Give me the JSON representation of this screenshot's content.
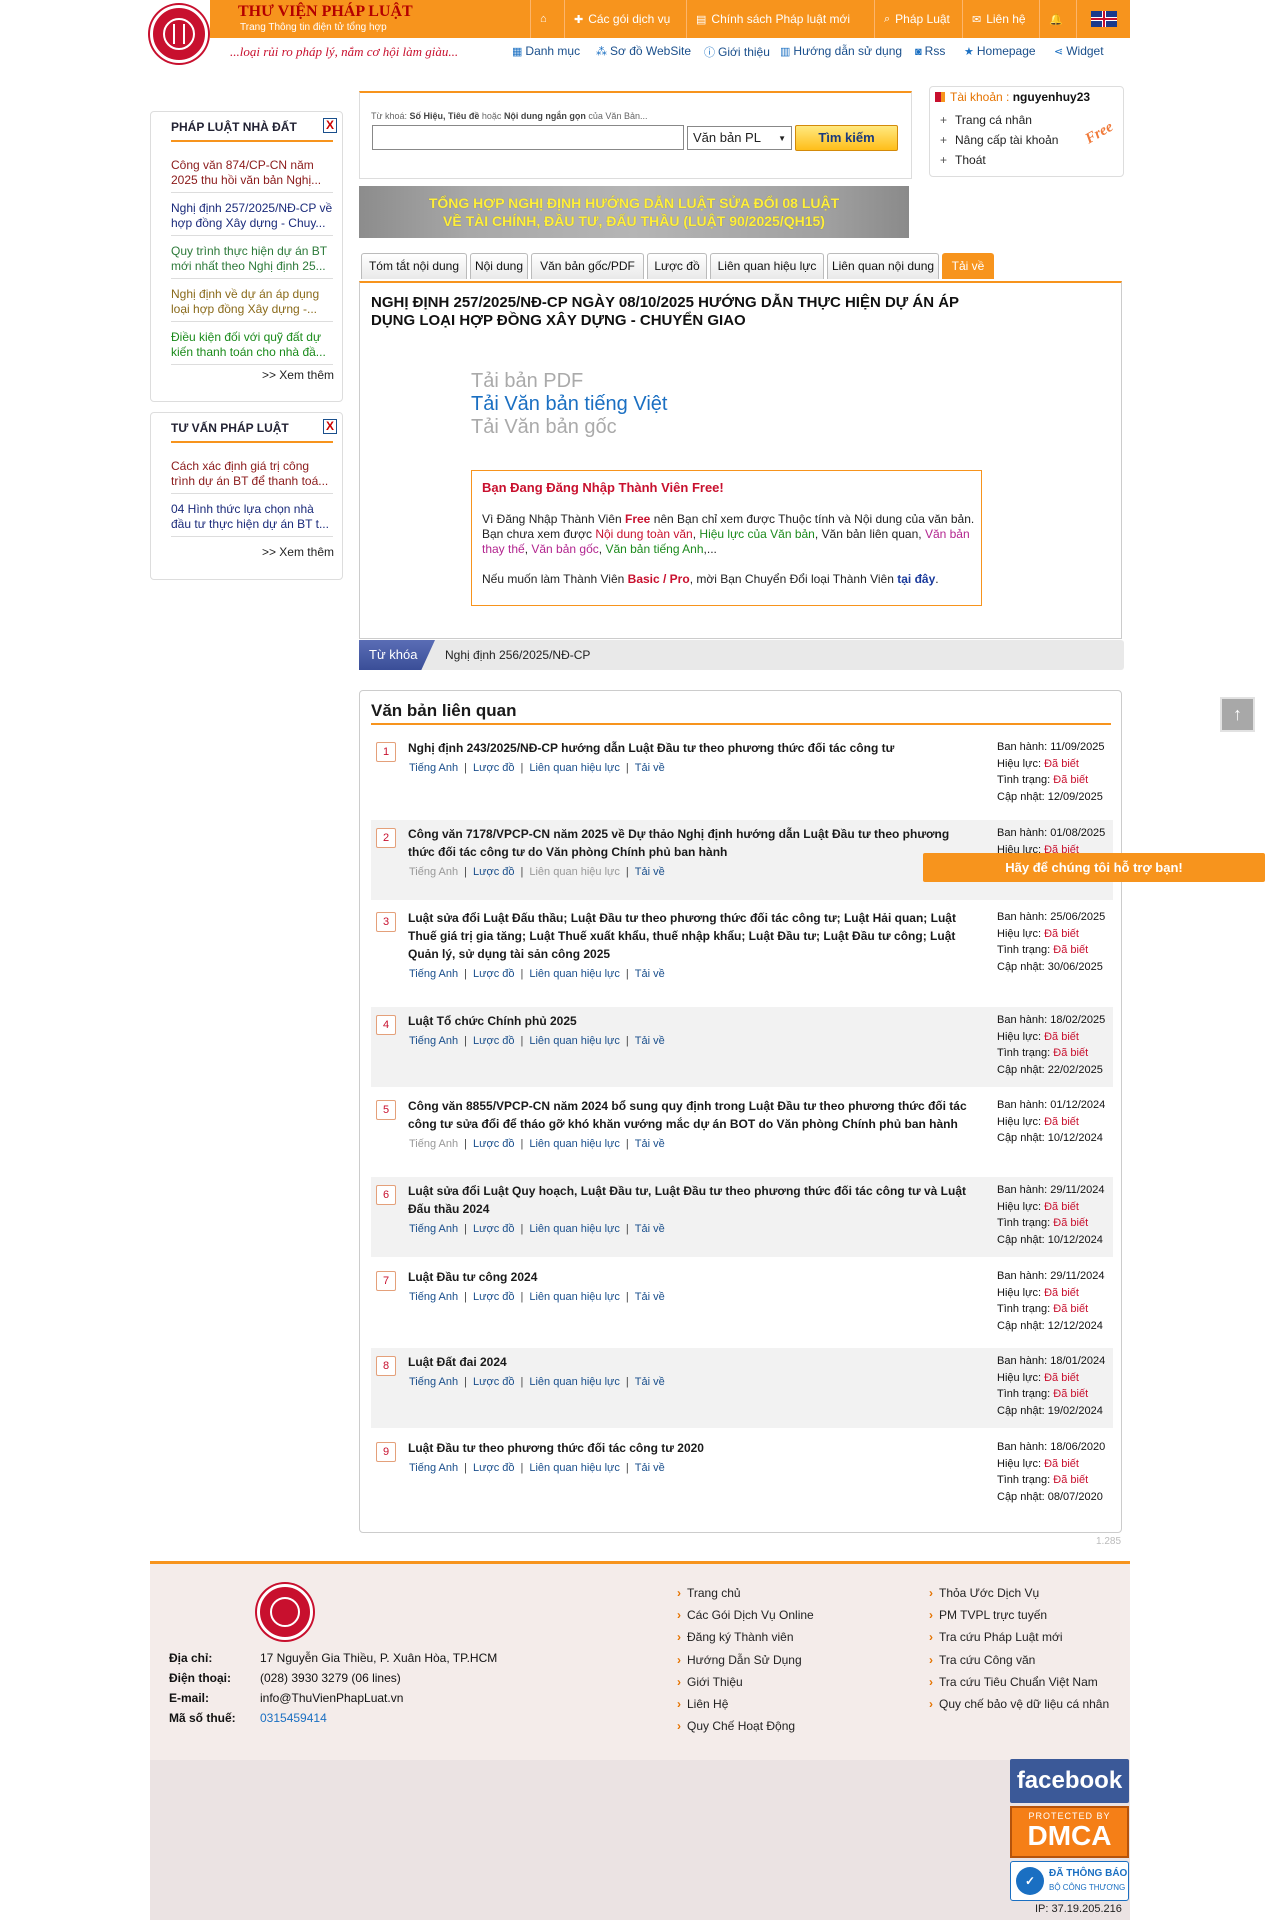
{
  "header": {
    "brand_title": "THƯ VIỆN PHÁP LUẬT",
    "brand_sub": "Trang Thông tin điện tử tổng hợp",
    "slogan": "...loại rủi ro pháp lý, nắm cơ hội làm giàu...",
    "nav": [
      {
        "icon": "home-icon",
        "label": ""
      },
      {
        "icon": "services-icon",
        "label": "Các gói dịch vụ"
      },
      {
        "icon": "newspaper-icon",
        "label": "Chính sách Pháp luật mới"
      },
      {
        "icon": "search-icon",
        "label": "Pháp Luật"
      },
      {
        "icon": "mail-icon",
        "label": "Liên hệ"
      },
      {
        "icon": "bell-icon",
        "label": ""
      },
      {
        "icon": "uk-flag-icon",
        "label": ""
      }
    ],
    "subnav": [
      {
        "icon": "list-icon",
        "label": "Danh mục"
      },
      {
        "icon": "sitemap-icon",
        "label": "Sơ đồ WebSite"
      },
      {
        "icon": "info-icon",
        "label": "Giới thiệu"
      },
      {
        "icon": "book-icon",
        "label": "Hướng dẫn sử dụng"
      },
      {
        "icon": "rss-icon",
        "label": "Rss"
      },
      {
        "icon": "star-icon",
        "label": "Homepage"
      },
      {
        "icon": "share-icon",
        "label": "Widget"
      }
    ]
  },
  "sidebar": {
    "box1": {
      "title": "PHÁP LUẬT NHÀ ĐẤT",
      "close": "X",
      "items": [
        {
          "text": "Công văn 874/CP-CN năm 2025 thu hồi văn bản Nghị...",
          "color": "#8b1a1a"
        },
        {
          "text": "Nghị định 257/2025/NĐ-CP về hợp đồng Xây dựng - Chuy...",
          "color": "#1a2a7a"
        },
        {
          "text": "Quy trình thực hiện dự án BT mới nhất theo Nghị định 25...",
          "color": "#2d7a3a"
        },
        {
          "text": "Nghị định về dự án áp dụng loại hợp đồng Xây dựng -...",
          "color": "#8a6a1a"
        },
        {
          "text": "Điều kiện đối với quỹ đất dự kiến thanh toán cho nhà đầ...",
          "color": "#1a8a1a"
        }
      ],
      "more": ">> Xem thêm"
    },
    "box2": {
      "title": "TƯ VẤN PHÁP LUẬT",
      "close": "X",
      "items": [
        {
          "text": "Cách xác định giá trị công trình dự án BT để thanh toá...",
          "color": "#8b1a1a"
        },
        {
          "text": "04 Hình thức lựa chọn nhà đầu tư thực hiện dự án BT t...",
          "color": "#1a2a7a"
        }
      ],
      "more": ">> Xem thêm"
    }
  },
  "search": {
    "hint_pre": "Từ khoá: ",
    "hint_bold": "Số Hiệu, Tiêu đề",
    "hint_mid": " hoặc ",
    "hint_bold2": "Nội dung ngắn gọn",
    "hint_post": " của Văn Bản...",
    "value": "",
    "select_value": "Văn bản PL",
    "button": "Tìm kiếm"
  },
  "account": {
    "label": "Tài khoản : ",
    "username": "nguyenhuy23",
    "items": [
      "Trang cá nhân",
      "Nâng cấp tài khoản",
      "Thoát"
    ],
    "free_stamp": "Free"
  },
  "banner": {
    "line1": "TỔNG HỢP NGHỊ ĐỊNH HƯỚNG DẪN LUẬT SỬA ĐỔI 08 LUẬT",
    "line2": "VỀ TÀI CHÍNH, ĐẦU TƯ, ĐẤU THẦU (LUẬT 90/2025/QH15)"
  },
  "tabs": [
    "Tóm tắt nội dung",
    "Nội dung",
    "Văn bản gốc/PDF",
    "Lược đồ",
    "Liên quan hiệu lực",
    "Liên quan nội dung",
    "Tải về"
  ],
  "document": {
    "title": "NGHỊ ĐỊNH 257/2025/NĐ-CP NGÀY 08/10/2025 HƯỚNG DẪN THỰC HIỆN DỰ ÁN ÁP DỤNG LOẠI HỢP ĐỒNG XÂY DỰNG - CHUYỂN GIAO",
    "download_pdf": "Tải bản PDF",
    "download_vn": "Tải Văn bản tiếng Việt",
    "download_orig": "Tải Văn bản gốc"
  },
  "notice": {
    "title": "Bạn Đang Đăng Nhập Thành Viên Free!",
    "p1_a": "Vì Đăng Nhập Thành Viên ",
    "p1_free": "Free",
    "p1_b": " nên Bạn chỉ xem được Thuộc tính và Nội dung của văn bản.",
    "p2_a": "Bạn chưa xem được ",
    "p2_nd": "Nội dung toàn văn",
    "p2_sep1": ", ",
    "p2_hl": "Hiệu lực của Văn bản",
    "p2_b": ", Văn bản liên quan, ",
    "p2_vbtt": "Văn bản thay thế",
    "p2_sep2": ", ",
    "p2_vbg": "Văn bản gốc",
    "p2_sep3": ", ",
    "p2_ta": "Văn bản tiếng Anh",
    "p2_end": ",...",
    "p3_a": "Nếu muốn làm Thành Viên ",
    "p3_bp": "Basic / Pro",
    "p3_b": ", mời Bạn Chuyển Đổi loại Thành Viên ",
    "p3_link": "tại đây",
    "p3_end": "."
  },
  "keywords": {
    "label": "Từ khóa",
    "tag": "Nghị định 256/2025/NĐ-CP"
  },
  "related": {
    "title": "Văn bản liên quan",
    "meta_labels": {
      "issued": "Ban hành: ",
      "validity": "Hiệu lực: ",
      "status": "Tình trạng: ",
      "updated": "Cập nhật: "
    },
    "link_labels": [
      "Tiếng Anh",
      "Lược đồ",
      "Liên quan hiệu lực",
      "Tải về"
    ],
    "items": [
      {
        "num": "1",
        "title": "Nghị định 243/2025/NĐ-CP hướng dẫn Luật Đầu tư theo phương thức đối tác công tư",
        "issued": "11/09/2025",
        "validity": "Đã biết",
        "status": "Đã biết",
        "updated": "12/09/2025"
      },
      {
        "num": "2",
        "title": "Công văn 7178/VPCP-CN năm 2025 về Dự thảo Nghị định hướng dẫn Luật Đầu tư theo phương thức đối tác công tư do Văn phòng Chính phủ ban hành",
        "issued": "01/08/2025",
        "validity": "Đã biết",
        "status": "",
        "updated": ""
      },
      {
        "num": "3",
        "title": "Luật sửa đổi Luật Đấu thầu; Luật Đầu tư theo phương thức đối tác công tư; Luật Hải quan; Luật Thuế giá trị gia tăng; Luật Thuế xuất khẩu, thuế nhập khẩu; Luật Đầu tư; Luật Đầu tư công; Luật Quản lý, sử dụng tài sản công 2025",
        "issued": "25/06/2025",
        "validity": "Đã biết",
        "status": "Đã biết",
        "updated": "30/06/2025"
      },
      {
        "num": "4",
        "title": "Luật Tổ chức Chính phủ 2025",
        "issued": "18/02/2025",
        "validity": "Đã biết",
        "status": "Đã biết",
        "updated": "22/02/2025"
      },
      {
        "num": "5",
        "title": "Công văn 8855/VPCP-CN năm 2024 bổ sung quy định trong Luật Đầu tư theo phương thức đối tác công tư sửa đổi để tháo gỡ khó khăn vướng mắc dự án BOT do Văn phòng Chính phủ ban hành",
        "issued": "01/12/2024",
        "validity": "Đã biết",
        "status": "",
        "updated": "10/12/2024"
      },
      {
        "num": "6",
        "title": "Luật sửa đổi Luật Quy hoạch, Luật Đầu tư, Luật Đầu tư theo phương thức đối tác công tư và Luật Đấu thầu 2024",
        "issued": "29/11/2024",
        "validity": "Đã biết",
        "status": "Đã biết",
        "updated": "10/12/2024"
      },
      {
        "num": "7",
        "title": "Luật Đầu tư công 2024",
        "issued": "29/11/2024",
        "validity": "Đã biết",
        "status": "Đã biết",
        "updated": "12/12/2024"
      },
      {
        "num": "8",
        "title": "Luật Đất đai 2024",
        "issued": "18/01/2024",
        "validity": "Đã biết",
        "status": "Đã biết",
        "updated": "19/02/2024"
      },
      {
        "num": "9",
        "title": "Luật Đầu tư theo phương thức đối tác công tư 2020",
        "issued": "18/06/2020",
        "validity": "Đã biết",
        "status": "Đã biết",
        "updated": "08/07/2020"
      }
    ],
    "page_hits": "1.285"
  },
  "floating": {
    "help": "Hãy để chúng tôi hỗ trợ bạn!",
    "scroll_top": "↑"
  },
  "footer": {
    "address_label": "Địa chỉ:",
    "address": "17 Nguyễn Gia Thiều, P. Xuân Hòa, TP.HCM",
    "phone_label": "Điện thoại:",
    "phone": "(028) 3930 3279 (06 lines)",
    "email_label": "E-mail:",
    "email": "info@ThuVienPhapLuat.vn",
    "tax_label": "Mã số thuế:",
    "tax": "0315459414",
    "col1": [
      "Trang chủ",
      "Các Gói Dịch Vụ Online",
      "Đăng ký Thành viên",
      "Hướng Dẫn Sử Dụng",
      "Giới Thiệu",
      "Liên Hệ",
      "Quy Chế Hoạt Động"
    ],
    "col2": [
      "Thỏa Ước Dịch Vụ",
      "PM TVPL trực tuyến",
      "Tra cứu Pháp Luật mới",
      "Tra cứu Công văn",
      "Tra cứu Tiêu Chuẩn Việt Nam",
      "Quy chế bảo vệ dữ liệu cá nhân"
    ],
    "fb": "facebook",
    "dmca_small": "PROTECTED BY",
    "dmca_big": "DMCA",
    "bct_1": "ĐÃ THÔNG BÁO",
    "bct_2": "BỘ CÔNG THƯƠNG",
    "ip": "IP: 37.19.205.216"
  },
  "colors": {
    "accent": "#f7941d",
    "brand_red": "#c8102e",
    "link_blue": "#1a4f8c"
  }
}
